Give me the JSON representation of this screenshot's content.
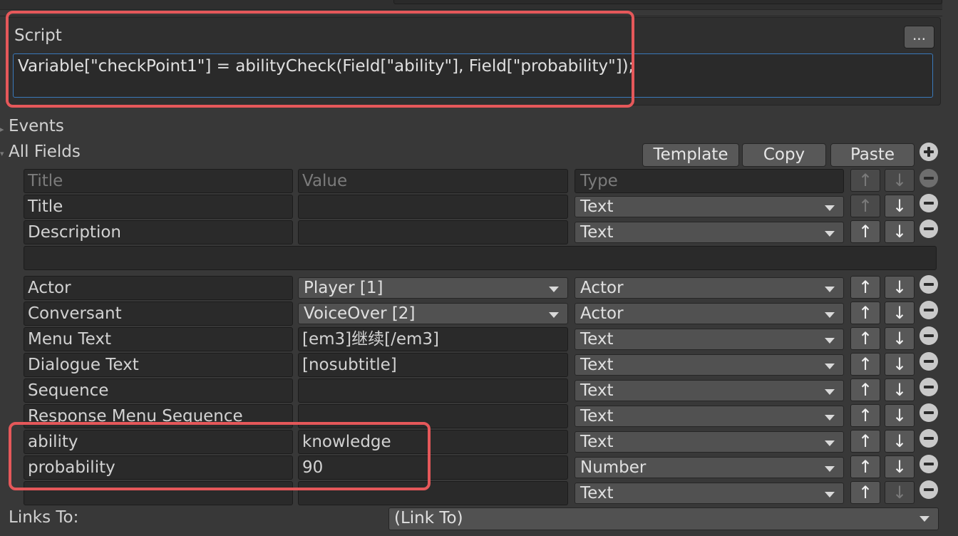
{
  "script": {
    "label": "Script",
    "more_button": "...",
    "code": "Variable[\"checkPoint1\"] = abilityCheck(Field[\"ability\"], Field[\"probability\"]);"
  },
  "events": {
    "label": "Events"
  },
  "all_fields": {
    "label": "All Fields",
    "template_button": "Template",
    "copy_button": "Copy",
    "paste_button": "Paste",
    "header": {
      "title": "Title",
      "value": "Value",
      "type": "Type"
    },
    "rows": [
      {
        "title": "Title",
        "value": "",
        "type": "Text"
      },
      {
        "title": "Description",
        "value": "",
        "type": "Text"
      },
      {
        "title": "Actor",
        "value": "Player [1]",
        "type": "Actor"
      },
      {
        "title": "Conversant",
        "value": "VoiceOver [2]",
        "type": "Actor"
      },
      {
        "title": "Menu Text",
        "value": "[em3]继续[/em3]",
        "type": "Text"
      },
      {
        "title": "Dialogue Text",
        "value": "[nosubtitle]",
        "type": "Text"
      },
      {
        "title": "Sequence",
        "value": "",
        "type": "Text"
      },
      {
        "title": "Response Menu Sequence",
        "value": "",
        "type": "Text"
      },
      {
        "title": "ability",
        "value": "knowledge",
        "type": "Text"
      },
      {
        "title": "probability",
        "value": "90",
        "type": "Number"
      },
      {
        "title": "",
        "value": "",
        "type": "Text"
      }
    ]
  },
  "links": {
    "label": "Links To:",
    "selected": "(Link To)"
  },
  "icons": {
    "up": "↑",
    "down": "↓"
  },
  "colors": {
    "highlight": "#e5585a",
    "focus": "#3a79bb"
  }
}
